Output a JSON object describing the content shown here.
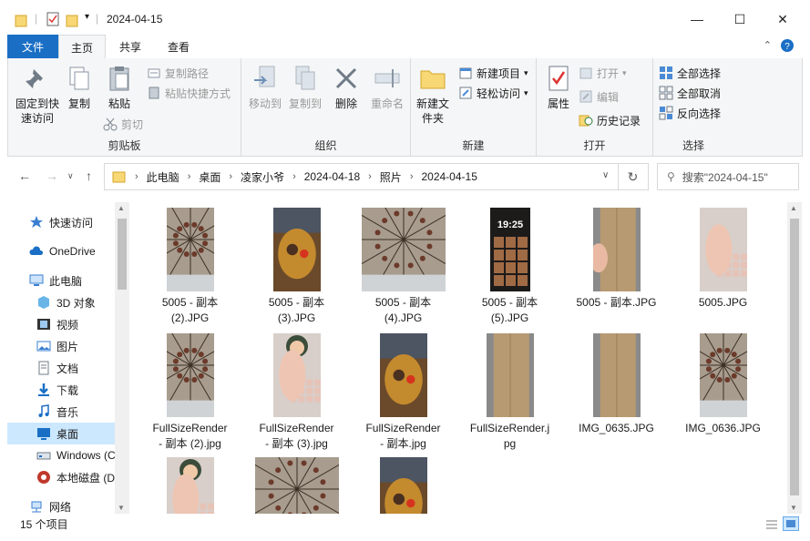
{
  "window": {
    "title": "2024-04-15",
    "minimize": "—",
    "maximize": "☐",
    "close": "✕"
  },
  "tabs": {
    "file": "文件",
    "home": "主页",
    "share": "共享",
    "view": "查看"
  },
  "ribbon": {
    "clipboard": {
      "label": "剪贴板",
      "pin": "固定到快速访问",
      "copy": "复制",
      "paste": "粘贴",
      "copy_path": "复制路径",
      "paste_shortcut": "粘贴快捷方式",
      "cut": "剪切"
    },
    "organize": {
      "label": "组织",
      "move_to": "移动到",
      "copy_to": "复制到",
      "delete": "删除",
      "rename": "重命名"
    },
    "new": {
      "label": "新建",
      "new_folder": "新建文件夹",
      "new_item": "新建项目",
      "easy_access": "轻松访问"
    },
    "open": {
      "label": "打开",
      "properties": "属性",
      "open": "打开",
      "edit": "编辑",
      "history": "历史记录"
    },
    "select": {
      "label": "选择",
      "select_all": "全部选择",
      "select_none": "全部取消",
      "invert": "反向选择"
    }
  },
  "address": {
    "crumbs": [
      "此电脑",
      "桌面",
      "凌家小爷",
      "2024-04-18",
      "照片",
      "2024-04-15"
    ],
    "search_placeholder": "搜索\"2024-04-15\""
  },
  "navpane": {
    "items": [
      {
        "label": "快速访问",
        "icon": "star-icon"
      },
      {
        "label": "OneDrive",
        "icon": "cloud-icon"
      },
      {
        "label": "此电脑",
        "icon": "computer-icon"
      },
      {
        "label": "3D 对象",
        "icon": "cube-icon"
      },
      {
        "label": "视频",
        "icon": "video-icon"
      },
      {
        "label": "图片",
        "icon": "picture-icon"
      },
      {
        "label": "文档",
        "icon": "document-icon"
      },
      {
        "label": "下载",
        "icon": "download-icon"
      },
      {
        "label": "音乐",
        "icon": "music-icon"
      },
      {
        "label": "桌面",
        "icon": "desktop-icon"
      },
      {
        "label": "Windows (C",
        "icon": "drive-icon"
      },
      {
        "label": "本地磁盘 (D",
        "icon": "drive-icon"
      },
      {
        "label": "网络",
        "icon": "network-icon"
      }
    ]
  },
  "files": [
    {
      "name": "5005 - 副本\n(2).JPG",
      "kind": "umbrella"
    },
    {
      "name": "5005 - 副本\n(3).JPG",
      "kind": "figure"
    },
    {
      "name": "5005 - 副本\n(4).JPG",
      "kind": "umbrella-wide"
    },
    {
      "name": "5005 - 副本\n(5).JPG",
      "kind": "phone"
    },
    {
      "name": "5005 - 副本.JPG",
      "kind": "box-hand"
    },
    {
      "name": "5005.JPG",
      "kind": "hand"
    },
    {
      "name": "FullSizeRender\n- 副本 (2).jpg",
      "kind": "umbrella"
    },
    {
      "name": "FullSizeRender\n- 副本 (3).jpg",
      "kind": "hand-figure"
    },
    {
      "name": "FullSizeRender\n- 副本.jpg",
      "kind": "figure"
    },
    {
      "name": "FullSizeRender.j\npg",
      "kind": "box"
    },
    {
      "name": "IMG_0635.JPG",
      "kind": "box"
    },
    {
      "name": "IMG_0636.JPG",
      "kind": "umbrella"
    },
    {
      "name": "",
      "kind": "hand-figure"
    },
    {
      "name": "",
      "kind": "umbrella-wide"
    },
    {
      "name": "",
      "kind": "figure"
    }
  ],
  "status": {
    "count": "15 个项目"
  },
  "colors": {
    "accent": "#1a6fc5",
    "selected": "#cce8ff",
    "folder": "#f8d775"
  }
}
